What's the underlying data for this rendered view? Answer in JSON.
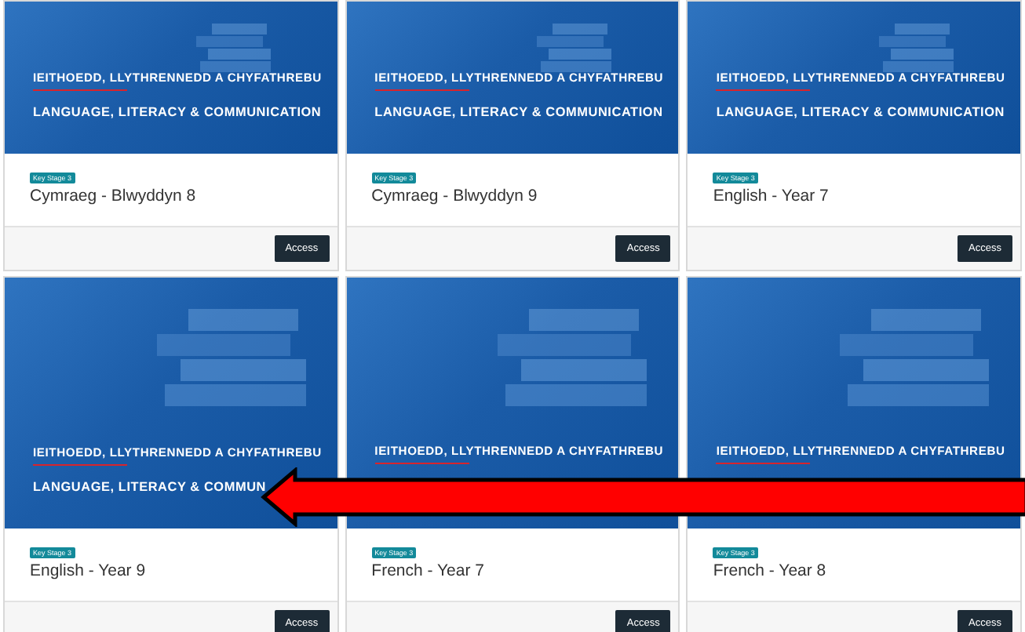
{
  "cards": [
    {
      "heading": "IEITHOEDD, LLYTHRENNEDD A CHYFATHREBU",
      "subheading": "LANGUAGE, LITERACY & COMMUNICATION",
      "badge": "Key Stage 3",
      "title": "Cymraeg - Blwyddyn 8",
      "button": "Access"
    },
    {
      "heading": "IEITHOEDD, LLYTHRENNEDD A CHYFATHREBU",
      "subheading": "LANGUAGE, LITERACY & COMMUNICATION",
      "badge": "Key Stage 3",
      "title": "Cymraeg - Blwyddyn 9",
      "button": "Access"
    },
    {
      "heading": "IEITHOEDD, LLYTHRENNEDD A CHYFATHREBU",
      "subheading": "LANGUAGE, LITERACY & COMMUNICATION",
      "badge": "Key Stage 3",
      "title": "English - Year 7",
      "button": "Access"
    },
    {
      "heading": "IEITHOEDD, LLYTHRENNEDD A CHYFATHREBU",
      "subheading": "LANGUAGE, LITERACY & COMMUN",
      "badge": "Key Stage 3",
      "title": "English - Year 9",
      "button": "Access"
    },
    {
      "heading": "IEITHOEDD, LLYTHRENNEDD A CHYFATHREBU",
      "badge": "Key Stage 3",
      "title": "French - Year 7",
      "button": "Access"
    },
    {
      "heading": "IEITHOEDD, LLYTHRENNEDD A CHYFATHREBU",
      "badge": "Key Stage 3",
      "title": "French - Year 8",
      "button": "Access"
    }
  ]
}
